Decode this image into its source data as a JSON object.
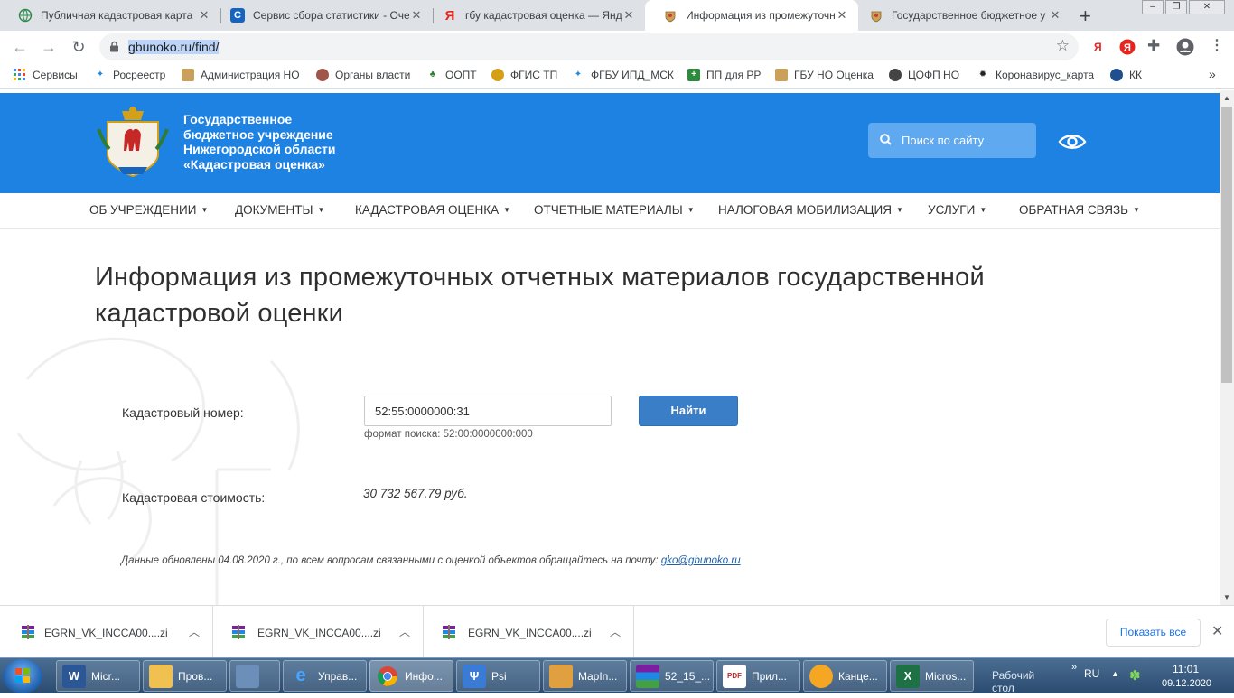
{
  "browser": {
    "tabs": [
      {
        "title": "Публичная кадастровая карта",
        "icon": "globe-icon",
        "active": false
      },
      {
        "title": "Сервис сбора статистики - Оче",
        "icon": "c-letter-icon",
        "active": false
      },
      {
        "title": "гбу кадастровая оценка — Янд",
        "icon": "yandex-icon",
        "active": false
      },
      {
        "title": "Информация из промежуточн",
        "icon": "emblem-icon",
        "active": true
      },
      {
        "title": "Государственное бюджетное у",
        "icon": "emblem-icon",
        "active": false
      }
    ],
    "url_text": "gbunoko.ru/find/",
    "ya_label": "Я",
    "bookmarks": [
      {
        "label": "Сервисы",
        "icon": "apps-grid-icon"
      },
      {
        "label": "Росреестр",
        "icon": "rosreestr-icon"
      },
      {
        "label": "Администрация НО",
        "icon": "emblem-icon"
      },
      {
        "label": "Органы власти",
        "icon": "emblem-icon"
      },
      {
        "label": "ООПТ",
        "icon": "nature-icon"
      },
      {
        "label": "ФГИС ТП",
        "icon": "eagle-icon"
      },
      {
        "label": "ФГБУ ИПД_МСК",
        "icon": "rosreestr-icon"
      },
      {
        "label": "ПП для РР",
        "icon": "plus-square-icon"
      },
      {
        "label": "ГБУ НО Оценка",
        "icon": "emblem-icon"
      },
      {
        "label": "ЦОФП НО",
        "icon": "globe-icon"
      },
      {
        "label": "Коронавирус_карта",
        "icon": "virus-icon"
      },
      {
        "label": "КК",
        "icon": "kk-icon"
      }
    ],
    "overflow": "»"
  },
  "site": {
    "org_lines": [
      "Государственное",
      "бюджетное учреждение",
      "Нижегородской области",
      "«Кадастровая оценка»"
    ],
    "search_placeholder": "Поиск по сайту",
    "nav": [
      {
        "label": "ОБ УЧРЕЖДЕНИИ"
      },
      {
        "label": "ДОКУМЕНТЫ"
      },
      {
        "label": "КАДАСТРОВАЯ ОЦЕНКА"
      },
      {
        "label": "ОТЧЕТНЫЕ МАТЕРИАЛЫ"
      },
      {
        "label": "НАЛОГОВАЯ МОБИЛИЗАЦИЯ"
      },
      {
        "label": "УСЛУГИ"
      },
      {
        "label": "ОБРАТНАЯ СВЯЗЬ"
      }
    ],
    "caret": "▼",
    "colors": {
      "header_blue": "#1e82e3",
      "button_blue": "#3a7ec8"
    }
  },
  "form": {
    "title": "Информация из промежуточных отчетных материалов государственной кадастровой оценки",
    "cadastral_label": "Кадастровый номер:",
    "cadastral_value": "52:55:0000000:31",
    "find_button": "Найти",
    "format_hint": "формат поиска: 52:00:0000000:000",
    "cost_label": "Кадастровая стоимость:",
    "cost_value": "30 732 567.79 руб.",
    "footnote_text": "Данные обновлены 04.08.2020 г., по всем вопросам связанными с оценкой объектов обращайтесь на почту: ",
    "footnote_email": "gko@gbunoko.ru"
  },
  "downloads": {
    "items": [
      {
        "name": "EGRN_VK_INCCA00....zi"
      },
      {
        "name": "EGRN_VK_INCCA00....zi"
      },
      {
        "name": "EGRN_VK_INCCA00....zi"
      }
    ],
    "show_all": "Показать все"
  },
  "taskbar": {
    "items": [
      {
        "label": "Micr...",
        "icon": "word-icon"
      },
      {
        "label": "Пров...",
        "icon": "folder-icon"
      },
      {
        "label": "",
        "icon": "computer-icon"
      },
      {
        "label": "Управ...",
        "icon": "ie-icon"
      },
      {
        "label": "Инфо...",
        "icon": "chrome-icon"
      },
      {
        "label": "Psi",
        "icon": "psi-icon"
      },
      {
        "label": "MapIn...",
        "icon": "mapinfo-icon"
      },
      {
        "label": "52_15_...",
        "icon": "winrar-icon"
      },
      {
        "label": "Прил...",
        "icon": "pdf-icon"
      },
      {
        "label": "Канце...",
        "icon": "office-icon"
      },
      {
        "label": "Micros...",
        "icon": "excel-icon"
      }
    ],
    "desktop_label": "Рабочий стол",
    "lang": "RU",
    "time": "11:01",
    "date": "09.12.2020"
  }
}
